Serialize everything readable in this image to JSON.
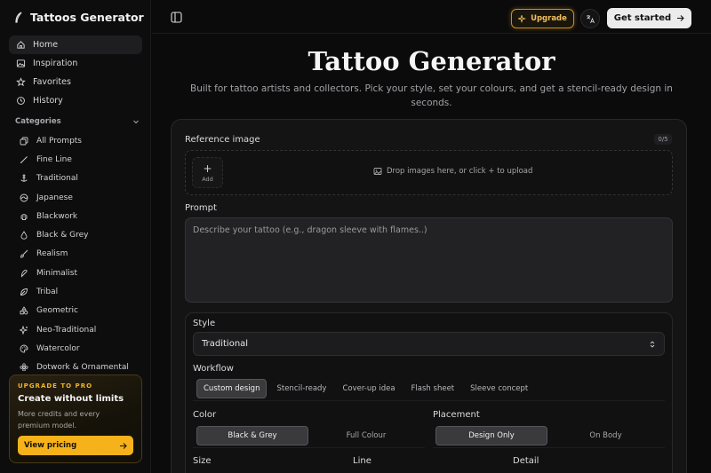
{
  "brand": {
    "name": "Tattoos Generator"
  },
  "nav": [
    {
      "label": "Home",
      "icon": "home-icon",
      "active": true
    },
    {
      "label": "Inspiration",
      "icon": "image-icon"
    },
    {
      "label": "Favorites",
      "icon": "star-icon"
    },
    {
      "label": "History",
      "icon": "history-icon"
    }
  ],
  "categories": {
    "heading": "Categories",
    "items": [
      {
        "label": "All Prompts",
        "icon": "copy-icon"
      },
      {
        "label": "Fine Line",
        "icon": "pen-line-icon"
      },
      {
        "label": "Traditional",
        "icon": "anchor-icon"
      },
      {
        "label": "Japanese",
        "icon": "wave-icon"
      },
      {
        "label": "Blackwork",
        "icon": "skull-icon"
      },
      {
        "label": "Black & Grey",
        "icon": "droplet-icon"
      },
      {
        "label": "Realism",
        "icon": "brush-icon"
      },
      {
        "label": "Minimalist",
        "icon": "feather-icon"
      },
      {
        "label": "Tribal",
        "icon": "leaf-icon"
      },
      {
        "label": "Geometric",
        "icon": "shapes-icon"
      },
      {
        "label": "Neo-Traditional",
        "icon": "sparkles-icon"
      },
      {
        "label": "Watercolor",
        "icon": "palette-icon"
      },
      {
        "label": "Dotwork & Ornamental",
        "icon": "flower-icon"
      }
    ]
  },
  "upgrade_card": {
    "kicker": "UPGRADE TO PRO",
    "title": "Create without limits",
    "desc": "More credits and every premium model.",
    "cta": "View pricing"
  },
  "topbar": {
    "upgrade_label": "Upgrade",
    "get_started_label": "Get started"
  },
  "hero": {
    "title": "Tattoo Generator",
    "subtitle": "Built for tattoo artists and collectors. Pick your style, set your colours, and get a stencil-ready design in seconds."
  },
  "form": {
    "reference_label": "Reference image",
    "reference_count": "0/5",
    "add_label": "Add",
    "drop_hint": "Drop images here, or click + to upload",
    "prompt_label": "Prompt",
    "prompt_placeholder": "Describe your tattoo (e.g., dragon sleeve with flames..)",
    "style_label": "Style",
    "style_value": "Traditional",
    "workflow_label": "Workflow",
    "workflow_options": [
      "Custom design",
      "Stencil-ready",
      "Cover-up idea",
      "Flash sheet",
      "Sleeve concept"
    ],
    "workflow_selected": "Custom design",
    "color_label": "Color",
    "color_options": [
      "Black & Grey",
      "Full Colour"
    ],
    "color_selected": "Black & Grey",
    "placement_label": "Placement",
    "placement_options": [
      "Design Only",
      "On Body"
    ],
    "placement_selected": "Design Only",
    "size_label": "Size",
    "line_label": "Line",
    "detail_label": "Detail"
  },
  "colors": {
    "accent": "#f6b21a",
    "background": "#0b0b0c"
  }
}
